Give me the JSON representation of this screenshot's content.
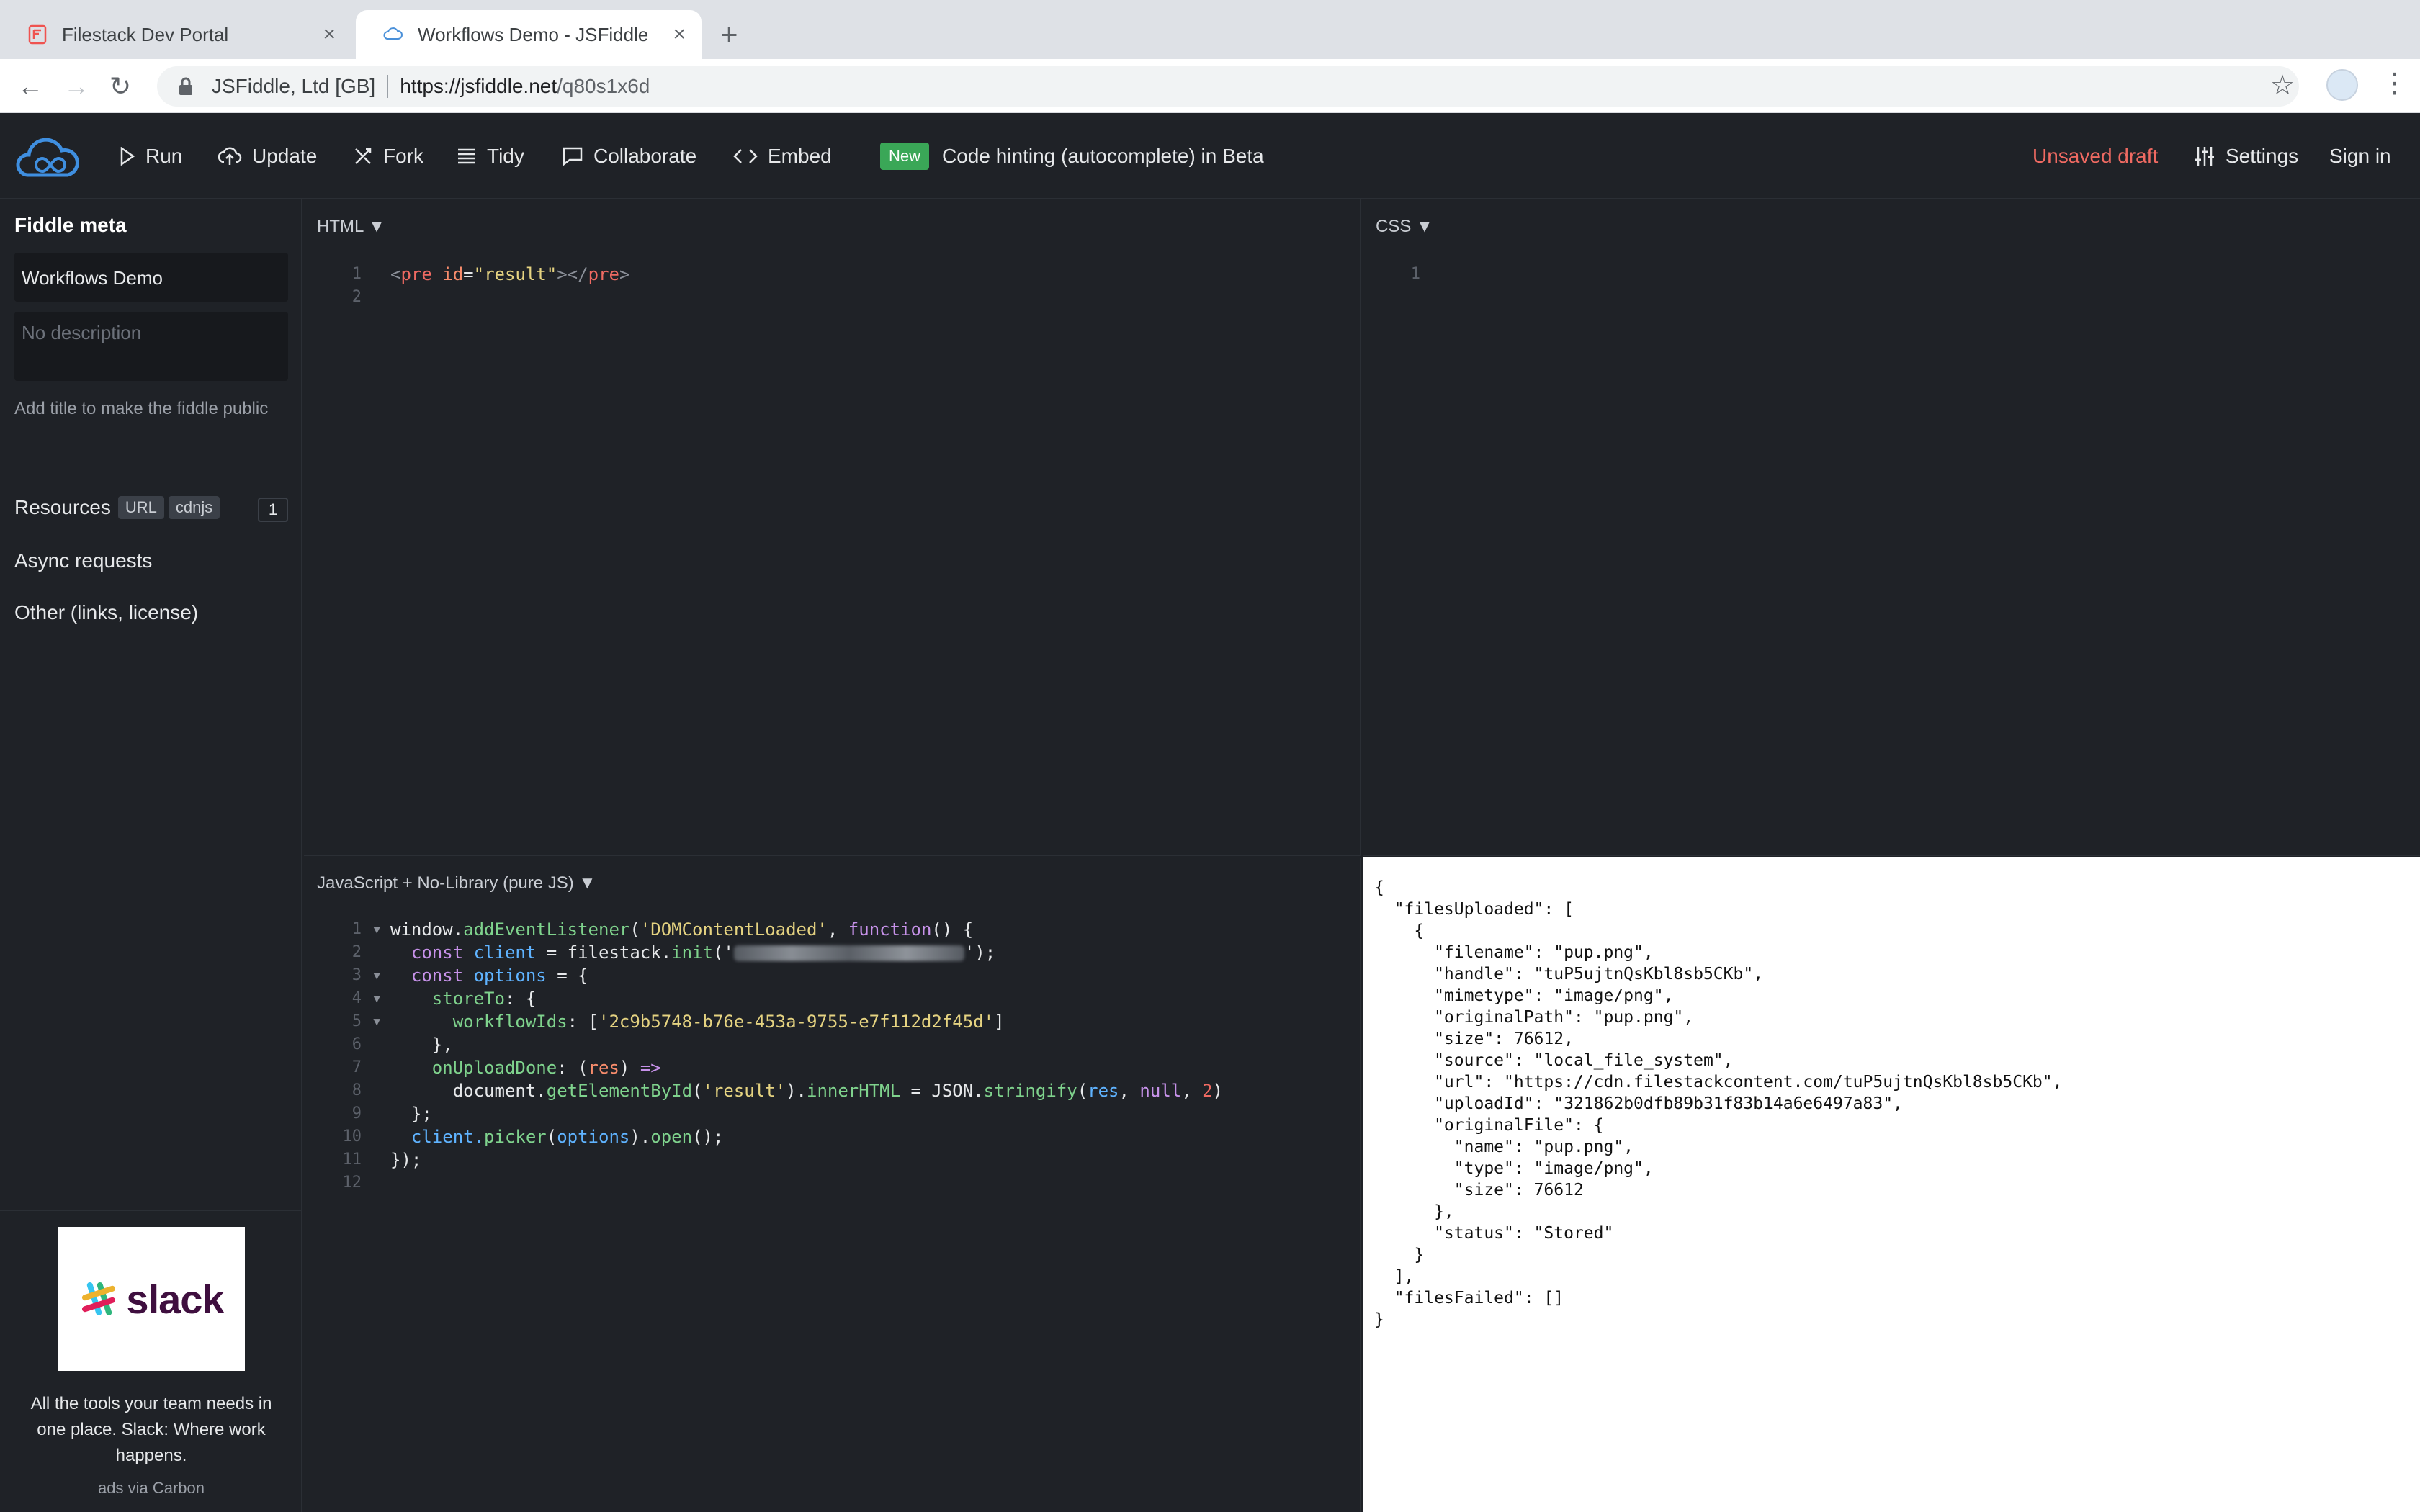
{
  "browser": {
    "tabs": [
      {
        "title": "Filestack Dev Portal"
      },
      {
        "title": "Workflows Demo - JSFiddle"
      }
    ],
    "security_label": "JSFiddle, Ltd [GB]",
    "url_domain": "https://jsfiddle.net",
    "url_path": "/q80s1x6d"
  },
  "toolbar": {
    "run": "Run",
    "update": "Update",
    "fork": "Fork",
    "tidy": "Tidy",
    "collaborate": "Collaborate",
    "embed": "Embed",
    "new_badge": "New",
    "announcement": "Code hinting (autocomplete) in Beta",
    "unsaved": "Unsaved draft",
    "settings": "Settings",
    "signin": "Sign in"
  },
  "sidebar": {
    "meta_heading": "Fiddle meta",
    "title_value": "Workflows Demo",
    "description_placeholder": "No description",
    "hint": "Add title to make the fiddle public",
    "resources": "Resources",
    "resource_url": "URL",
    "resource_cdnjs": "cdnjs",
    "resource_count": "1",
    "async": "Async requests",
    "other": "Other (links, license)"
  },
  "ad": {
    "brand": "slack",
    "text": "All the tools your team needs in one place. Slack: Where work happens.",
    "by": "ads via Carbon"
  },
  "panels": {
    "html_label": "HTML ▼",
    "css_label": "CSS ▼",
    "js_label": "JavaScript + No-Library (pure JS) ▼"
  },
  "html_code": {
    "line1_open": "<",
    "line1_tag": "pre",
    "line1_attr": " id",
    "line1_eq": "=",
    "line1_val": "\"result\"",
    "line1_close": "></",
    "line1_tag2": "pre",
    "line1_end": ">"
  },
  "js_code": {
    "l1a": "window.",
    "l1b": "addEventListener",
    "l1c": "(",
    "l1d": "'DOMContentLoaded'",
    "l1e": ", ",
    "l1f": "function",
    "l1g": "() {",
    "l2a": "  const ",
    "l2b": "client",
    "l2c": " = ",
    "l2d": "filestack.",
    "l2e": "init",
    "l2f": "('",
    "l2g": "');",
    "l3a": "  const ",
    "l3b": "options",
    "l3c": " = {",
    "l4a": "    storeTo",
    "l4b": ": {",
    "l5a": "      workflowIds",
    "l5b": ": [",
    "l5c": "'2c9b5748-b76e-453a-9755-e7f112d2f45d'",
    "l5d": "]",
    "l6": "    },",
    "l7a": "    onUploadDone",
    "l7b": ": (",
    "l7c": "res",
    "l7d": ") ",
    "l7e": "=>",
    "l8a": "      document.",
    "l8b": "getElementById",
    "l8c": "(",
    "l8d": "'result'",
    "l8e": ").",
    "l8f": "innerHTML",
    "l8g": " = ",
    "l8h": "JSON.",
    "l8i": "stringify",
    "l8j": "(",
    "l8k": "res",
    "l8l": ", ",
    "l8m": "null",
    "l8n": ", ",
    "l8o": "2",
    "l8p": ")",
    "l9": "  };",
    "l10a": "  client.",
    "l10b": "picker",
    "l10c": "(",
    "l10d": "options",
    "l10e": ").",
    "l10f": "open",
    "l10g": "();",
    "l11": "});"
  },
  "result_output": "{\n  \"filesUploaded\": [\n    {\n      \"filename\": \"pup.png\",\n      \"handle\": \"tuP5ujtnQsKbl8sb5CKb\",\n      \"mimetype\": \"image/png\",\n      \"originalPath\": \"pup.png\",\n      \"size\": 76612,\n      \"source\": \"local_file_system\",\n      \"url\": \"https://cdn.filestackcontent.com/tuP5ujtnQsKbl8sb5CKb\",\n      \"uploadId\": \"321862b0dfb89b31f83b14a6e6497a83\",\n      \"originalFile\": {\n        \"name\": \"pup.png\",\n        \"type\": \"image/png\",\n        \"size\": 76612\n      },\n      \"status\": \"Stored\"\n    }\n  ],\n  \"filesFailed\": []\n}"
}
